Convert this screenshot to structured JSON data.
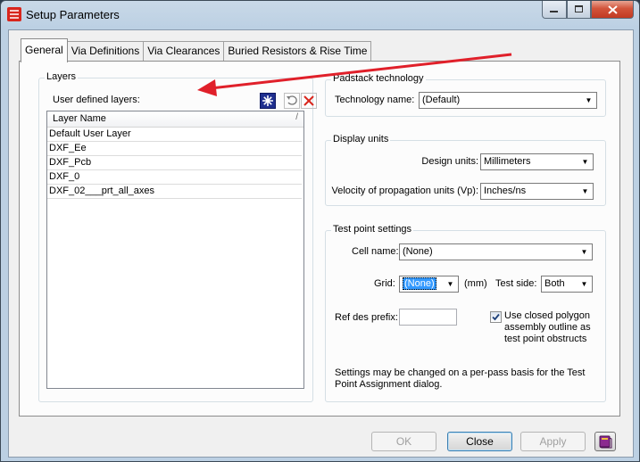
{
  "window": {
    "title": "Setup Parameters"
  },
  "tabs": [
    "General",
    "Via Definitions",
    "Via Clearances",
    "Buried Resistors & Rise Time"
  ],
  "layers": {
    "legend": "Layers",
    "user_defined_label": "User defined layers:",
    "column_header": "Layer Name",
    "sort_glyph": "/",
    "rows": [
      "Default User Layer",
      "DXF_Ee",
      "DXF_Pcb",
      "DXF_0",
      "DXF_02___prt_all_axes"
    ]
  },
  "padstack": {
    "legend": "Padstack technology",
    "tech_label": "Technology name:",
    "tech_value": "(Default)"
  },
  "display_units": {
    "legend": "Display units",
    "design_label": "Design units:",
    "design_value": "Millimeters",
    "velocity_label": "Velocity of propagation units (Vp):",
    "velocity_value": "Inches/ns"
  },
  "test_point": {
    "legend": "Test point settings",
    "cell_label": "Cell name:",
    "cell_value": "(None)",
    "grid_label": "Grid:",
    "grid_value": "(None)",
    "grid_unit": "(mm)",
    "side_label": "Test side:",
    "side_value": "Both",
    "refdes_label": "Ref des prefix:",
    "refdes_value": "",
    "closed_polygon_label_1": "Use closed polygon",
    "closed_polygon_label_2": "assembly outline as",
    "closed_polygon_label_3": "test point obstructs",
    "closed_polygon_checked": true,
    "note_1": "Settings may be changed on a per-pass basis for the Test",
    "note_2": "Point Assignment dialog."
  },
  "buttons": {
    "ok": "OK",
    "close": "Close",
    "apply": "Apply"
  },
  "colors": {
    "accent": "#3399ff",
    "arrow": "#e0202a",
    "close_button": "#c23a22"
  }
}
